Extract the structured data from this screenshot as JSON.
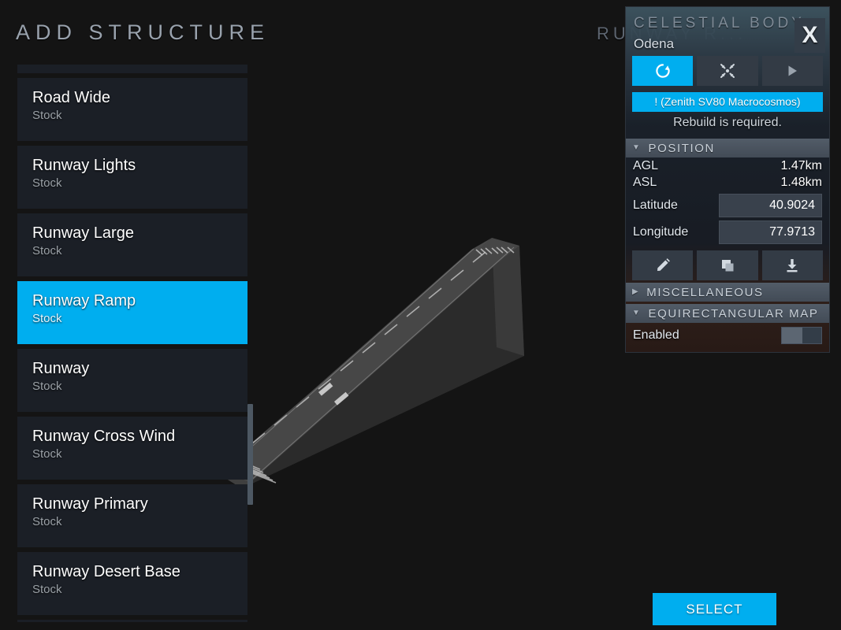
{
  "picker": {
    "title": "ADD STRUCTURE",
    "items": [
      {
        "name": "",
        "sub": "",
        "partial": "top"
      },
      {
        "name": "Road Wide",
        "sub": "Stock"
      },
      {
        "name": "Runway Lights",
        "sub": "Stock"
      },
      {
        "name": "Runway Large",
        "sub": "Stock"
      },
      {
        "name": "Runway Ramp",
        "sub": "Stock",
        "selected": true
      },
      {
        "name": "Runway",
        "sub": "Stock"
      },
      {
        "name": "Runway Cross Wind",
        "sub": "Stock"
      },
      {
        "name": "Runway Primary",
        "sub": "Stock"
      },
      {
        "name": "Runway Desert Base",
        "sub": "Stock"
      },
      {
        "name": "",
        "sub": "",
        "partial": "bottom"
      }
    ]
  },
  "ghost_title": "RUNWAY R...",
  "inspector": {
    "kicker": "CELESTIAL BODY",
    "subject": "Odena",
    "close_label": "X",
    "toolbar": [
      {
        "icon": "rebuild-icon",
        "label": "Rebuild",
        "active": true
      },
      {
        "icon": "focus-icon",
        "label": "Focus",
        "active": false
      },
      {
        "icon": "play-icon",
        "label": "Play",
        "active": false
      }
    ],
    "warning_banner": "! (Zenith SV80 Macrocosmos)",
    "warning_sub": "Rebuild is required.",
    "position": {
      "header": "POSITION",
      "expanded": true,
      "caret": "▼",
      "rows": [
        {
          "key": "AGL",
          "value": "1.47km"
        },
        {
          "key": "ASL",
          "value": "1.48km"
        }
      ],
      "fields": [
        {
          "label": "Latitude",
          "value": "40.9024"
        },
        {
          "label": "Longitude",
          "value": "77.9713"
        }
      ],
      "actions": [
        {
          "icon": "pencil-icon",
          "label": "Edit"
        },
        {
          "icon": "duplicate-icon",
          "label": "Duplicate"
        },
        {
          "icon": "download-icon",
          "label": "Download"
        }
      ]
    },
    "miscellaneous": {
      "header": "MISCELLANEOUS",
      "expanded": false,
      "caret": "▶"
    },
    "equirectangular_map": {
      "header": "EQUIRECTANGULAR MAP",
      "expanded": true,
      "caret": "▼",
      "toggle_label": "Enabled",
      "toggle_on": false
    }
  },
  "select_button": "SELECT",
  "colors": {
    "accent": "#00aeef",
    "panel_bg": "#1a212a",
    "list_item_bg": "#1b1f26",
    "app_bg": "#131313",
    "text_primary": "#ffffff",
    "text_muted": "#9aa0a6"
  }
}
